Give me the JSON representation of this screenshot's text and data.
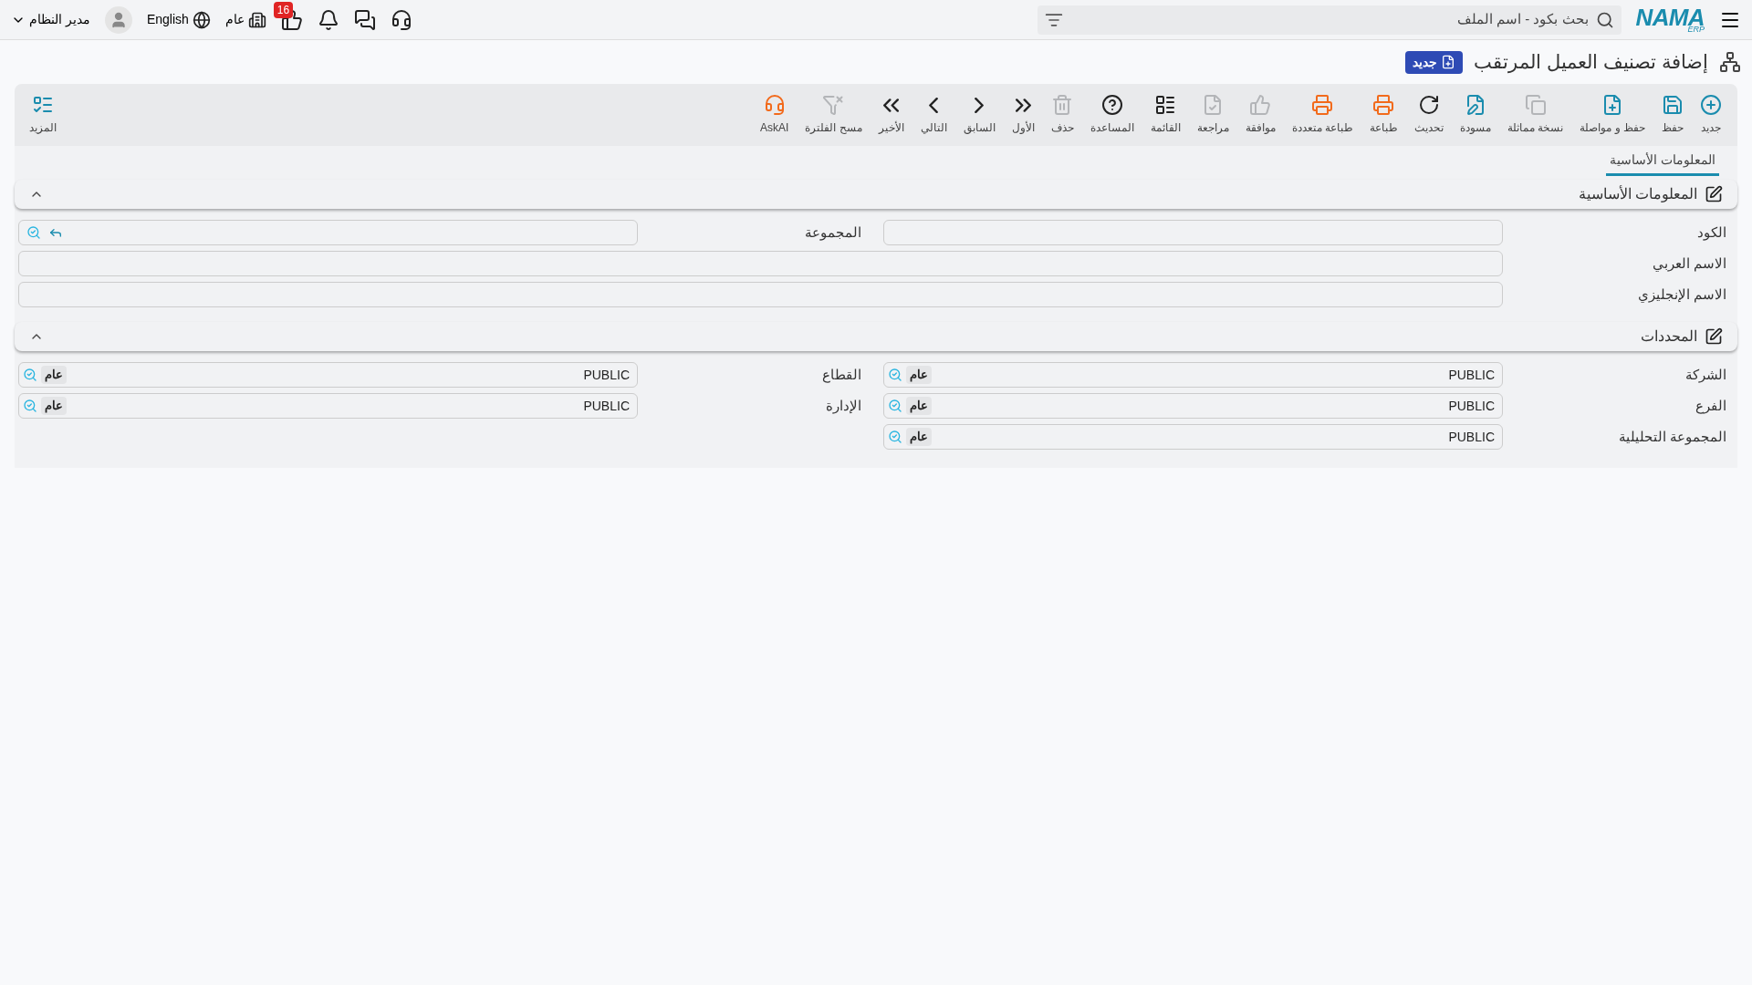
{
  "header": {
    "logo": {
      "name": "NAMA",
      "sub": "ERP"
    },
    "search": {
      "placeholder": "بحث بكود - اسم الملف"
    },
    "notifications_badge": "16",
    "company": "عام",
    "language": "English",
    "user": "مدير النظام"
  },
  "page": {
    "title": "إضافة تصنيف العميل المرتقب",
    "status": "جديد"
  },
  "toolbar": [
    {
      "label": "جديد",
      "kind": "primary",
      "disabled": false
    },
    {
      "label": "حفظ",
      "kind": "primary",
      "disabled": false
    },
    {
      "label": "حفظ و مواصلة",
      "kind": "primary",
      "disabled": false
    },
    {
      "label": "نسخة مماثلة",
      "disabled": true
    },
    {
      "label": "مسودة",
      "kind": "primary",
      "disabled": false
    },
    {
      "label": "تحديث",
      "kind": "plain",
      "disabled": false
    },
    {
      "label": "طباعة",
      "kind": "accent",
      "disabled": false
    },
    {
      "label": "طباعة متعددة",
      "kind": "accent",
      "disabled": false
    },
    {
      "label": "موافقة",
      "disabled": true
    },
    {
      "label": "مراجعة",
      "disabled": true
    },
    {
      "label": "القائمة",
      "kind": "plain",
      "disabled": false
    },
    {
      "label": "المساعدة",
      "kind": "plain",
      "disabled": false
    },
    {
      "label": "حذف",
      "disabled": true
    },
    {
      "label": "الأول",
      "kind": "plain",
      "disabled": false
    },
    {
      "label": "السابق",
      "kind": "plain",
      "disabled": false
    },
    {
      "label": "التالي",
      "kind": "plain",
      "disabled": false
    },
    {
      "label": "الأخير",
      "kind": "plain",
      "disabled": false
    },
    {
      "label": "مسح الفلترة",
      "disabled": true
    },
    {
      "label": "AskAI",
      "kind": "accent",
      "disabled": false
    }
  ],
  "more": {
    "label": "المزيد"
  },
  "tabs": [
    {
      "label": "المعلومات الأساسية",
      "selected": true
    }
  ],
  "sections": [
    {
      "title": "المعلومات الأساسية",
      "expanded": true,
      "rows": [
        [
          {
            "label": "الكود",
            "kind": "text"
          },
          {
            "label": "المجموعة",
            "kind": "link-lookup"
          }
        ],
        [
          {
            "label": "الاسم العربي",
            "kind": "text"
          }
        ],
        [
          {
            "label": "الاسم الإنجليزي",
            "kind": "text"
          }
        ]
      ]
    },
    {
      "title": "المحددات",
      "expanded": true,
      "rows": [
        [
          {
            "label": "الشركة",
            "kind": "lookup",
            "value": "PUBLIC",
            "tag": "عام"
          },
          {
            "label": "القطاع",
            "kind": "lookup",
            "value": "PUBLIC",
            "tag": "عام"
          }
        ],
        [
          {
            "label": "الفرع",
            "kind": "lookup",
            "value": "PUBLIC",
            "tag": "عام"
          },
          {
            "label": "الإدارة",
            "kind": "lookup",
            "value": "PUBLIC",
            "tag": "عام"
          }
        ],
        [
          {
            "label": "المجموعة التحليلية",
            "kind": "lookup",
            "value": "PUBLIC",
            "tag": "عام"
          }
        ]
      ]
    }
  ]
}
